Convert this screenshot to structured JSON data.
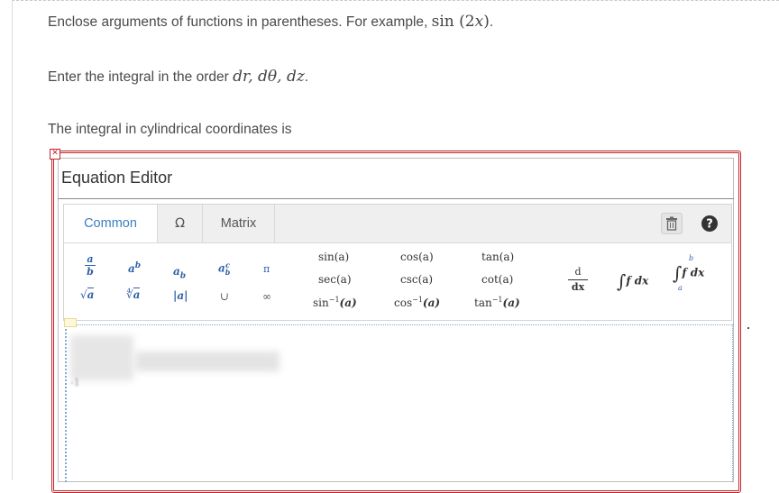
{
  "instructions": {
    "line1_prefix": "Enclose arguments of functions in parentheses. For example, ",
    "line1_math": "sin (2x)",
    "line1_suffix": ".",
    "line2_prefix": "Enter the integral in the order ",
    "line2_math": "dr,  dθ,  dz",
    "line2_suffix": ".",
    "line3": "The integral in cylindrical coordinates is"
  },
  "editor": {
    "close_glyph": "✕",
    "title": "Equation Editor",
    "tabs": [
      {
        "label": "Common"
      },
      {
        "label": "Ω"
      },
      {
        "label": "Matrix"
      }
    ],
    "toolbar": {
      "trash_icon": "trash-icon",
      "help_icon": "help-icon",
      "help_glyph": "?"
    },
    "symbols": {
      "frac_num": "a",
      "frac_den": "b",
      "pow_base": "a",
      "pow_exp": "b",
      "sub_base": "a",
      "sub_sub": "b",
      "subsup_base": "a",
      "subsup_sup": "c",
      "subsup_sub": "b",
      "pi": "π",
      "sqrt_arg": "a",
      "nroot_arg": "a",
      "abs": "|a|",
      "union": "∪",
      "infinity": "∞",
      "sin": "sin(a)",
      "cos": "cos(a)",
      "tan": "tan(a)",
      "sec": "sec(a)",
      "csc": "csc(a)",
      "cot": "cot(a)",
      "asin_fn": "sin",
      "acos_fn": "cos",
      "atan_fn": "tan",
      "inv_exp": "−1",
      "inv_arg": "(a)",
      "deriv_num": "d",
      "deriv_den": "dx",
      "integral": "∫",
      "integrand": "f dx",
      "def_upper": "b",
      "def_lower": "a"
    },
    "entry_hint": "-1"
  },
  "colors": {
    "frame": "#c0252a",
    "active_tab": "#3a7fc1",
    "tab_bar": "#efefef"
  }
}
